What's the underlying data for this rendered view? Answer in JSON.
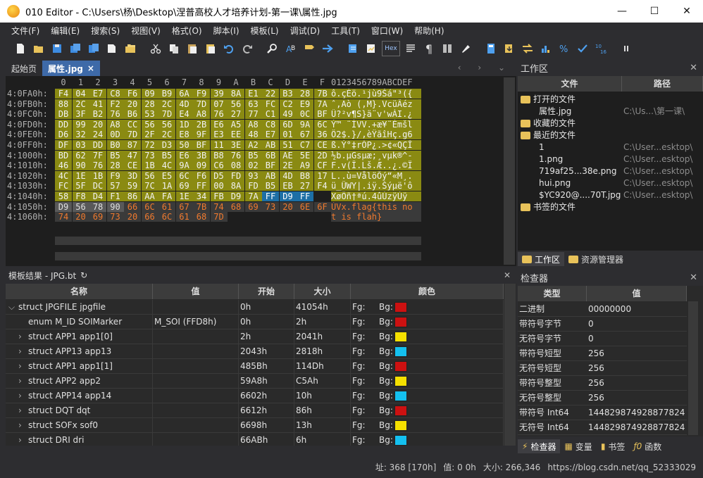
{
  "window": {
    "title": "010 Editor - C:\\Users\\杨\\Desktop\\涅普高校人才培养计划-第一课\\属性.jpg",
    "minimize": "—",
    "maximize": "☐",
    "close": "✕"
  },
  "menu": [
    "文件(F)",
    "编辑(E)",
    "搜索(S)",
    "视图(V)",
    "格式(O)",
    "脚本(I)",
    "模板(L)",
    "调试(D)",
    "工具(T)",
    "窗口(W)",
    "帮助(H)"
  ],
  "toolbar": {
    "hex_label": "Hex",
    "pilcrow": "¶"
  },
  "tabs": [
    {
      "label": "起始页"
    },
    {
      "label": "属性.jpg",
      "close": "×"
    }
  ],
  "tab_nav": "‹ › ⌄",
  "hex": {
    "column_headers": [
      "0",
      "1",
      "2",
      "3",
      "4",
      "5",
      "6",
      "7",
      "8",
      "9",
      "A",
      "B",
      "C",
      "D",
      "E",
      "F"
    ],
    "ascii_header": "0123456789ABCDEF",
    "rows": [
      {
        "addr": "4:0FA0h:",
        "bytes": [
          "F4",
          "04",
          "E7",
          "C8",
          "F6",
          "09",
          "B9",
          "6A",
          "F9",
          "39",
          "8A",
          "E1",
          "22",
          "B3",
          "28",
          "7B"
        ],
        "ascii": "ô.çÈö.¹jù9Šá\"³({"
      },
      {
        "addr": "4:0FB0h:",
        "bytes": [
          "88",
          "2C",
          "41",
          "F2",
          "20",
          "28",
          "2C",
          "4D",
          "7D",
          "07",
          "56",
          "63",
          "FC",
          "C2",
          "E9",
          "7A"
        ],
        "ascii": "ˆ,Aò (,M}.VcüÂéz"
      },
      {
        "addr": "4:0FC0h:",
        "bytes": [
          "DB",
          "3F",
          "B2",
          "76",
          "B6",
          "53",
          "7D",
          "E4",
          "A8",
          "76",
          "27",
          "77",
          "C1",
          "49",
          "0C",
          "BF"
        ],
        "ascii": "Û?²v¶S}ä¨v'wÁI.¿"
      },
      {
        "addr": "4:0FD0h:",
        "bytes": [
          "DD",
          "99",
          "20",
          "A8",
          "CC",
          "56",
          "56",
          "1D",
          "2B",
          "E6",
          "A5",
          "A8",
          "C8",
          "6D",
          "9A",
          "6C"
        ],
        "ascii": "Ý™ ¨ÌVV.+æ¥¨Èmšl"
      },
      {
        "addr": "4:0FE0h:",
        "bytes": [
          "D6",
          "32",
          "24",
          "0D",
          "7D",
          "2F",
          "2C",
          "E8",
          "9F",
          "E3",
          "EE",
          "48",
          "E7",
          "01",
          "67",
          "36"
        ],
        "ascii": "Ö2$.}/,èŸãîHç.g6"
      },
      {
        "addr": "4:0FF0h:",
        "bytes": [
          "DF",
          "03",
          "DD",
          "B0",
          "87",
          "72",
          "D3",
          "50",
          "BF",
          "11",
          "3E",
          "A2",
          "AB",
          "51",
          "C7",
          "CE"
        ],
        "ascii": "ß.Ý°‡rÓP¿.>¢«QÇÎ"
      },
      {
        "addr": "4:1000h:",
        "bytes": [
          "BD",
          "62",
          "7F",
          "B5",
          "47",
          "73",
          "B5",
          "E6",
          "3B",
          "B8",
          "76",
          "B5",
          "6B",
          "AE",
          "5E",
          "2D"
        ],
        "ascii": "½b.µGsµæ;¸vµk®^-"
      },
      {
        "addr": "4:1010h:",
        "bytes": [
          "46",
          "90",
          "76",
          "28",
          "CE",
          "1B",
          "4C",
          "9A",
          "09",
          "C6",
          "08",
          "02",
          "BF",
          "2E",
          "A9",
          "CF"
        ],
        "ascii": "F.v(Î.Lš.Æ..¿.©Ï"
      },
      {
        "addr": "4:1020h:",
        "bytes": [
          "4C",
          "1E",
          "1B",
          "F9",
          "3D",
          "56",
          "E5",
          "6C",
          "F6",
          "D5",
          "FD",
          "93",
          "AB",
          "4D",
          "B8",
          "17"
        ],
        "ascii": "L..ù=VålöÕý“«M¸."
      },
      {
        "addr": "4:1030h:",
        "bytes": [
          "FC",
          "5F",
          "DC",
          "57",
          "59",
          "7C",
          "1A",
          "69",
          "FF",
          "00",
          "8A",
          "FD",
          "B5",
          "EB",
          "27",
          "F4"
        ],
        "ascii": "ü_ÜWY|.iÿ.Šýµë'ô"
      },
      {
        "addr": "4:1040h:",
        "bytes": [
          "58",
          "F8",
          "D4",
          "F1",
          "86",
          "AA",
          "FA",
          "1E",
          "34",
          "FB",
          "D9",
          "7A",
          "FF",
          "D9",
          "FF"
        ],
        "ascii": "XøÔñ†ªú.4ûÙzÿÙÿ"
      },
      {
        "addr": "4:1050h:",
        "bytes": [
          "D9",
          "56",
          "78",
          "90",
          "66",
          "6C",
          "61",
          "67",
          "7B",
          "74",
          "68",
          "69",
          "73",
          "20",
          "6E",
          "6F"
        ],
        "ascii": "ÙVx.flag{this no"
      },
      {
        "addr": "4:1060h:",
        "bytes": [
          "74",
          "20",
          "69",
          "73",
          "20",
          "66",
          "6C",
          "61",
          "68",
          "7D"
        ],
        "ascii": "t is flah}"
      }
    ]
  },
  "template": {
    "title": "模板结果 - JPG.bt",
    "refresh_icon": "↻",
    "close": "✕",
    "columns": [
      "名称",
      "值",
      "开始",
      "大小",
      "颜色"
    ],
    "rows": [
      {
        "name": "struct JPGFILE jpgfile",
        "toggle": "⌵",
        "value": "",
        "start": "0h",
        "size": "41054h",
        "fg": "Fg:",
        "bg": "Bg:",
        "color": "#cc1111"
      },
      {
        "name": "enum M_ID SOIMarker",
        "toggle": "",
        "value": "M_SOI (FFD8h)",
        "start": "0h",
        "size": "2h",
        "fg": "Fg:",
        "bg": "Bg:",
        "color": "#cc1111"
      },
      {
        "name": "struct APP1 app1[0]",
        "toggle": "›",
        "value": "",
        "start": "2h",
        "size": "2041h",
        "fg": "Fg:",
        "bg": "Bg:",
        "color": "#f5e000"
      },
      {
        "name": "struct APP13 app13",
        "toggle": "›",
        "value": "",
        "start": "2043h",
        "size": "2818h",
        "fg": "Fg:",
        "bg": "Bg:",
        "color": "#14c0ef"
      },
      {
        "name": "struct APP1 app1[1]",
        "toggle": "›",
        "value": "",
        "start": "485Bh",
        "size": "114Dh",
        "fg": "Fg:",
        "bg": "Bg:",
        "color": "#cc1111"
      },
      {
        "name": "struct APP2 app2",
        "toggle": "›",
        "value": "",
        "start": "59A8h",
        "size": "C5Ah",
        "fg": "Fg:",
        "bg": "Bg:",
        "color": "#f5e000"
      },
      {
        "name": "struct APP14 app14",
        "toggle": "›",
        "value": "",
        "start": "6602h",
        "size": "10h",
        "fg": "Fg:",
        "bg": "Bg:",
        "color": "#14c0ef"
      },
      {
        "name": "struct DQT dqt",
        "toggle": "›",
        "value": "",
        "start": "6612h",
        "size": "86h",
        "fg": "Fg:",
        "bg": "Bg:",
        "color": "#cc1111"
      },
      {
        "name": "struct SOFx sof0",
        "toggle": "›",
        "value": "",
        "start": "6698h",
        "size": "13h",
        "fg": "Fg:",
        "bg": "Bg:",
        "color": "#f5e000"
      },
      {
        "name": "struct DRI dri",
        "toggle": "›",
        "value": "",
        "start": "66ABh",
        "size": "6h",
        "fg": "Fg:",
        "bg": "Bg:",
        "color": "#14c0ef"
      }
    ]
  },
  "workspace": {
    "title": "工作区",
    "close": "✕",
    "columns": [
      "文件",
      "路径"
    ],
    "rows": [
      {
        "type": "folder",
        "name": "打开的文件",
        "path": ""
      },
      {
        "type": "file",
        "name": "属性.jpg",
        "path": "C:\\Us...\\第一课\\"
      },
      {
        "type": "folder",
        "name": "收藏的文件",
        "path": ""
      },
      {
        "type": "folder",
        "name": "最近的文件",
        "path": ""
      },
      {
        "type": "file",
        "name": "1",
        "path": "C:\\User...esktop\\"
      },
      {
        "type": "file",
        "name": "1.png",
        "path": "C:\\User...esktop\\"
      },
      {
        "type": "file",
        "name": "719af25...38e.png",
        "path": "C:\\User...esktop\\"
      },
      {
        "type": "file",
        "name": "hui.png",
        "path": "C:\\User...esktop\\"
      },
      {
        "type": "file",
        "name": "$YC920@....70T.jpg",
        "path": "C:\\User...esktop\\"
      },
      {
        "type": "folder",
        "name": "书签的文件",
        "path": ""
      }
    ],
    "tabs": [
      "工作区",
      "资源管理器"
    ]
  },
  "inspector": {
    "title": "检查器",
    "close": "✕",
    "columns": [
      "类型",
      "值"
    ],
    "rows": [
      {
        "type": "二进制",
        "value": "00000000"
      },
      {
        "type": "带符号字节",
        "value": "0"
      },
      {
        "type": "无符号字节",
        "value": "0"
      },
      {
        "type": "带符号短型",
        "value": "256"
      },
      {
        "type": "无符号短型",
        "value": "256"
      },
      {
        "type": "带符号整型",
        "value": "256"
      },
      {
        "type": "无符号整型",
        "value": "256"
      },
      {
        "type": "带符号 Int64",
        "value": "144829874928877824"
      },
      {
        "type": "无符号 Int64",
        "value": "144829874928877824"
      }
    ],
    "tabs": [
      "检查器",
      "变量",
      "书签",
      "函数"
    ]
  },
  "status": {
    "address": "址: 368 [170h]",
    "value": "值: 0 0h",
    "size": "大小: 266,346",
    "extra": "https://blog.csdn.net/qq_52333029"
  }
}
